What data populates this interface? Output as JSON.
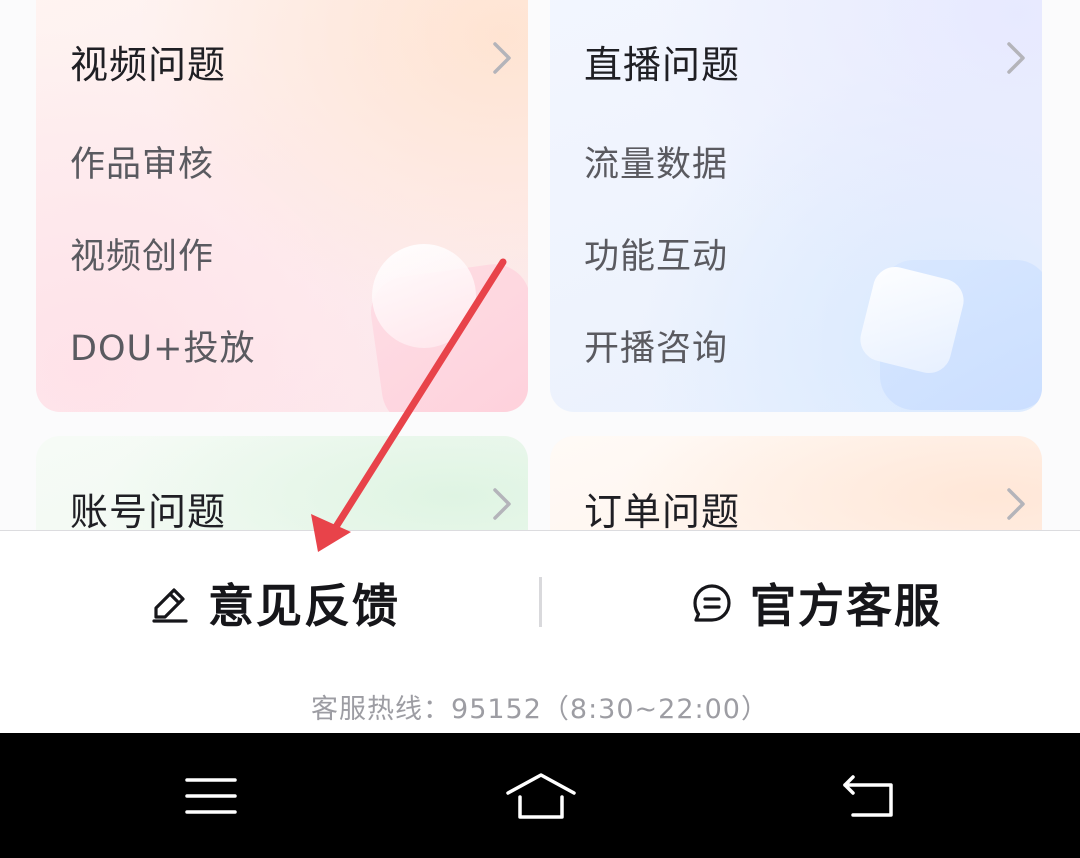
{
  "categories": [
    {
      "title": "视频问题",
      "items": [
        "作品审核",
        "视频创作",
        "DOU+投放"
      ]
    },
    {
      "title": "直播问题",
      "items": [
        "流量数据",
        "功能互动",
        "开播咨询"
      ]
    },
    {
      "title": "账号问题",
      "items": []
    },
    {
      "title": "订单问题",
      "items": []
    }
  ],
  "actions": {
    "feedback_label": "意见反馈",
    "service_label": "官方客服"
  },
  "hotline": "客服热线：95152（8:30~22:00）",
  "icons": {
    "feedback": "pencil-icon",
    "service": "chat-bubble-icon",
    "category_arrow": "chevron-right-icon",
    "nav_menu": "menu-icon",
    "nav_home": "home-icon",
    "nav_back": "back-icon"
  },
  "colors": {
    "annotation_arrow": "#e8434a",
    "title_text": "#1f1f24",
    "sub_text": "#5a5a60",
    "hotline_text": "#9d9da3",
    "nav_bar": "#000000"
  }
}
